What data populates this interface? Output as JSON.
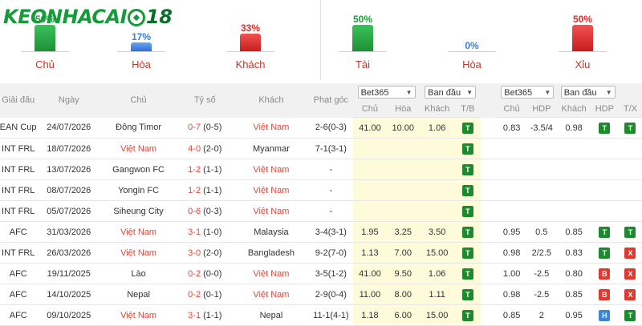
{
  "logo": {
    "text_a": "KEONHACAI",
    "text_b": "18"
  },
  "stats_left": [
    {
      "pct": "50%",
      "label": "Chủ",
      "level": 0.5,
      "color": "green"
    },
    {
      "pct": "17%",
      "label": "Hòa",
      "level": 0.17,
      "color": "blue"
    },
    {
      "pct": "33%",
      "label": "Khách",
      "level": 0.33,
      "color": "red"
    }
  ],
  "stats_right": [
    {
      "pct": "50%",
      "label": "Tài",
      "level": 0.5,
      "color": "green"
    },
    {
      "pct": "0%",
      "label": "Hòa",
      "level": 0.0,
      "color": "blue"
    },
    {
      "pct": "50%",
      "label": "Xỉu",
      "level": 0.5,
      "color": "red"
    }
  ],
  "headers": {
    "league": "Giải đấu",
    "date": "Ngày",
    "home": "Chủ",
    "score": "Tỷ số",
    "away": "Khách",
    "corner": "Phạt góc",
    "bookmaker1": "Bet365",
    "type1": "Ban đầu",
    "bookmaker2": "Bet365",
    "type2": "Ban đầu",
    "sub": {
      "chu": "Chủ",
      "hoa": "Hòa",
      "khach": "Khách",
      "tb": "T/B",
      "chu2": "Chủ",
      "hdp": "HDP",
      "khach2": "Khách",
      "hdp2": "HDP",
      "tx": "T/X"
    }
  },
  "rows": [
    {
      "league": "ASEAN Cup",
      "date": "24/07/2026",
      "home": "Đông Timor",
      "home_vn": false,
      "score": "0-7",
      "ht": "(0-5)",
      "score_red": true,
      "away": "Việt Nam",
      "away_vn": true,
      "corner": "2-6(0-3)",
      "o1": "41.00",
      "o2": "10.00",
      "o3": "1.06",
      "tb": "T",
      "h1": "0.83",
      "h2": "-3.5/4",
      "h3": "0.98",
      "hdp": "T",
      "tx": "T"
    },
    {
      "league": "INT FRL",
      "date": "18/07/2026",
      "home": "Việt Nam",
      "home_vn": true,
      "score": "4-0",
      "ht": "(2-0)",
      "score_red": true,
      "away": "Myanmar",
      "away_vn": false,
      "corner": "7-1(3-1)",
      "o1": "",
      "o2": "",
      "o3": "",
      "tb": "T",
      "h1": "",
      "h2": "",
      "h3": "",
      "hdp": "",
      "tx": ""
    },
    {
      "league": "INT FRL",
      "date": "13/07/2026",
      "home": "Gangwon FC",
      "home_vn": false,
      "score": "1-2",
      "ht": "(1-1)",
      "score_red": true,
      "away": "Việt Nam",
      "away_vn": true,
      "corner": "-",
      "o1": "",
      "o2": "",
      "o3": "",
      "tb": "T",
      "h1": "",
      "h2": "",
      "h3": "",
      "hdp": "",
      "tx": ""
    },
    {
      "league": "INT FRL",
      "date": "08/07/2026",
      "home": "Yongin FC",
      "home_vn": false,
      "score": "1-2",
      "ht": "(1-1)",
      "score_red": true,
      "away": "Việt Nam",
      "away_vn": true,
      "corner": "-",
      "o1": "",
      "o2": "",
      "o3": "",
      "tb": "T",
      "h1": "",
      "h2": "",
      "h3": "",
      "hdp": "",
      "tx": ""
    },
    {
      "league": "INT FRL",
      "date": "05/07/2026",
      "home": "Siheung City",
      "home_vn": false,
      "score": "0-6",
      "ht": "(0-3)",
      "score_red": true,
      "away": "Việt Nam",
      "away_vn": true,
      "corner": "-",
      "o1": "",
      "o2": "",
      "o3": "",
      "tb": "T",
      "h1": "",
      "h2": "",
      "h3": "",
      "hdp": "",
      "tx": ""
    },
    {
      "league": "AFC",
      "date": "31/03/2026",
      "home": "Việt Nam",
      "home_vn": true,
      "score": "3-1",
      "ht": "(1-0)",
      "score_red": true,
      "away": "Malaysia",
      "away_vn": false,
      "corner": "3-4(3-1)",
      "o1": "1.95",
      "o2": "3.25",
      "o3": "3.50",
      "tb": "T",
      "h1": "0.95",
      "h2": "0.5",
      "h3": "0.85",
      "hdp": "T",
      "tx": "T"
    },
    {
      "league": "INT FRL",
      "date": "26/03/2026",
      "home": "Việt Nam",
      "home_vn": true,
      "score": "3-0",
      "ht": "(2-0)",
      "score_red": true,
      "away": "Bangladesh",
      "away_vn": false,
      "corner": "9-2(7-0)",
      "o1": "1.13",
      "o2": "7.00",
      "o3": "15.00",
      "tb": "T",
      "h1": "0.98",
      "h2": "2/2.5",
      "h3": "0.83",
      "hdp": "T",
      "tx": "X"
    },
    {
      "league": "AFC",
      "date": "19/11/2025",
      "home": "Lào",
      "home_vn": false,
      "score": "0-2",
      "ht": "(0-0)",
      "score_red": true,
      "away": "Việt Nam",
      "away_vn": true,
      "corner": "3-5(1-2)",
      "o1": "41.00",
      "o2": "9.50",
      "o3": "1.06",
      "tb": "T",
      "h1": "1.00",
      "h2": "-2.5",
      "h3": "0.80",
      "hdp": "B",
      "tx": "X"
    },
    {
      "league": "AFC",
      "date": "14/10/2025",
      "home": "Nepal",
      "home_vn": false,
      "score": "0-2",
      "ht": "(0-1)",
      "score_red": true,
      "away": "Việt Nam",
      "away_vn": true,
      "corner": "2-9(0-4)",
      "o1": "11.00",
      "o2": "8.00",
      "o3": "1.11",
      "tb": "T",
      "h1": "0.98",
      "h2": "-2.5",
      "h3": "0.85",
      "hdp": "B",
      "tx": "X"
    },
    {
      "league": "AFC",
      "date": "09/10/2025",
      "home": "Việt Nam",
      "home_vn": true,
      "score": "3-1",
      "ht": "(1-1)",
      "score_red": true,
      "away": "Nepal",
      "away_vn": false,
      "corner": "11-1(4-1)",
      "o1": "1.18",
      "o2": "6.00",
      "o3": "15.00",
      "tb": "T",
      "h1": "0.85",
      "h2": "2",
      "h3": "0.95",
      "hdp": "H",
      "tx": "T"
    }
  ]
}
